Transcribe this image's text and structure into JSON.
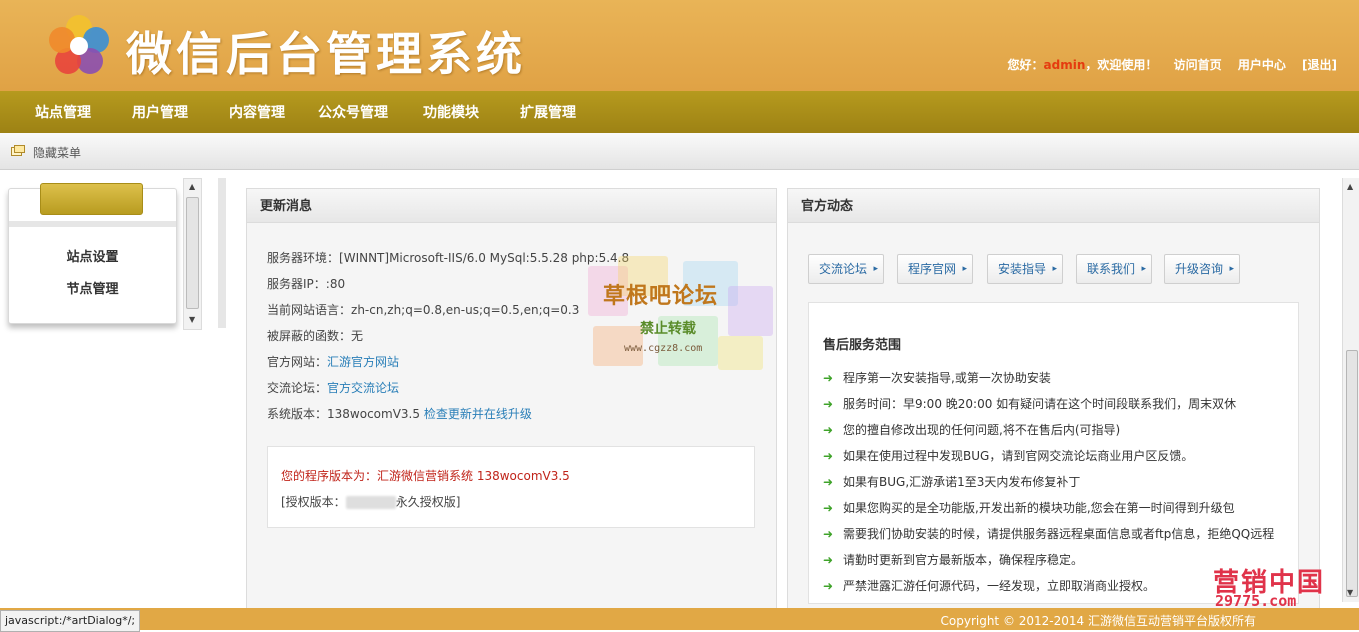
{
  "header": {
    "title": "微信后台管理系统",
    "greeting": "您好：",
    "username": "admin",
    "welcome": "，欢迎使用！",
    "links": [
      "访问首页",
      "用户中心",
      "[退出]"
    ]
  },
  "nav": {
    "items": [
      "站点管理",
      "用户管理",
      "内容管理",
      "公众号管理",
      "功能模块",
      "扩展管理"
    ]
  },
  "subbar": {
    "hide_menu": "隐藏菜单"
  },
  "sidebar": {
    "items": [
      "站点设置",
      "节点管理"
    ]
  },
  "update_panel": {
    "title": "更新消息",
    "lines": [
      {
        "label": "服务器环境：",
        "value": "[WINNT]Microsoft-IIS/6.0 MySql:5.5.28 php:5.4.8"
      },
      {
        "label": "服务器IP：",
        "value": ":80"
      },
      {
        "label": "当前网站语言：",
        "value": "zh-cn,zh;q=0.8,en-us;q=0.5,en;q=0.3"
      },
      {
        "label": "被屏蔽的函数：",
        "value": "无"
      },
      {
        "label": "官方网站：",
        "link": "汇游官方网站"
      },
      {
        "label": "交流论坛：",
        "link": "官方交流论坛"
      },
      {
        "label": "系统版本：",
        "value": "138wocomV3.5 ",
        "link": "检查更新并在线升级"
      }
    ],
    "version_text": "您的程序版本为：汇游微信营销系统 138wocomV3.5",
    "license_prefix": "[授权版本：",
    "license_suffix": "永久授权版]"
  },
  "official_panel": {
    "title": "官方动态",
    "buttons": [
      "交流论坛",
      "程序官网",
      "安装指导",
      "联系我们",
      "升级咨询"
    ],
    "service_title": "售后服务范围",
    "service_items": [
      "程序第一次安装指导,或第一次协助安装",
      "服务时间：早9:00 晚20:00 如有疑问请在这个时间段联系我们，周末双休",
      "您的擅自修改出现的任何问题,将不在售后内(可指导)",
      "如果在使用过程中发现BUG，请到官网交流论坛商业用户区反馈。",
      "如果有BUG,汇游承诺1至3天内发布修复补丁",
      "如果您购买的是全功能版,开发出新的模块功能,您会在第一时间得到升级包",
      "需要我们协助安装的时候，请提供服务器远程桌面信息或者ftp信息，拒绝QQ远程",
      "请勤时更新到官方最新版本，确保程序稳定。",
      "严禁泄露汇游任何源代码，一经发现，立即取消商业授权。"
    ]
  },
  "watermarks": {
    "center_title": "草根吧论坛",
    "center_sub": "禁止转载",
    "center_url": "www.cgzz8.com",
    "brand_title": "营销中国",
    "brand_url": "29775.com"
  },
  "footer": {
    "copyright": "Copyright © 2012-2014 汇游微信互动营销平台版权所有",
    "status_url": "javascript:/*artDialog*/;"
  },
  "icons": {
    "arrow": "▸",
    "go": "➜",
    "scroll_up": "▲",
    "scroll_down": "▼"
  },
  "colors": {
    "header_bg": "#e2a648",
    "nav_bg": "#a98d18",
    "username": "#e53b0f",
    "link": "#2a7fb8",
    "version_text": "#c0241a"
  }
}
